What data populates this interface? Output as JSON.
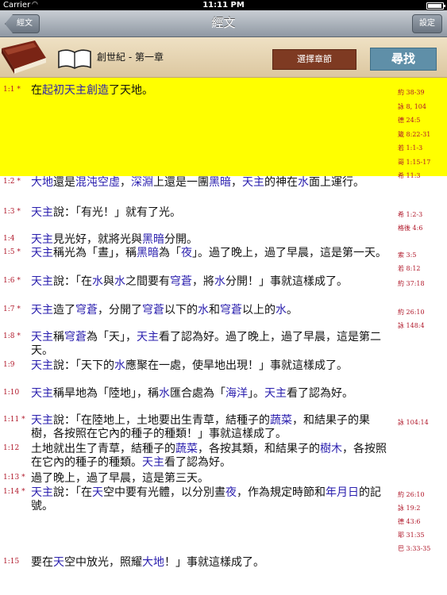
{
  "status": {
    "carrier": "Carrier",
    "wifi": "◠",
    "time": "11:11 PM",
    "battery_level": 0.95
  },
  "nav": {
    "back_label": "經文",
    "title": "經文",
    "settings_label": "設定"
  },
  "header": {
    "chapter_title": "創世紀 - 第一章",
    "select_label": "選擇章節",
    "search_label": "尋找"
  },
  "colors": {
    "highlight": "#ffff00",
    "keyword": "#2a1fae",
    "reference": "#b0182a",
    "select_button": "#7e3a22",
    "search_button": "#5f8fa8"
  },
  "verses": [
    {
      "num": "1:1 *",
      "highlight": true,
      "segments": [
        {
          "t": "在"
        },
        {
          "t": "起初",
          "k": 1
        },
        {
          "t": "天主",
          "k": 1
        },
        {
          "t": "創造",
          "k": 1
        },
        {
          "t": "了天地。"
        }
      ],
      "refs": [
        "約 38-39",
        "詠 8, 104",
        "德 24:5",
        "箴 8:22-31",
        "若 1:1-3",
        "哥 1:15-17",
        "希 11:3"
      ]
    },
    {
      "num": "1:2 *",
      "segments": [
        {
          "t": "大地",
          "k": 1
        },
        {
          "t": "還是"
        },
        {
          "t": "混沌",
          "k": 1
        },
        {
          "t": "空虛",
          "k": 1
        },
        {
          "t": "，"
        },
        {
          "t": "深淵",
          "k": 1
        },
        {
          "t": "上還是一團"
        },
        {
          "t": "黑暗",
          "k": 1
        },
        {
          "t": "，"
        },
        {
          "t": "天主",
          "k": 1
        },
        {
          "t": "的神在"
        },
        {
          "t": "水",
          "k": 1
        },
        {
          "t": "面上運行。"
        }
      ],
      "refs": []
    },
    {
      "num": "1:3 *",
      "segments": [
        {
          "t": "天主",
          "k": 1
        },
        {
          "t": "說：「有光！」就有了光。"
        }
      ],
      "refs": [
        "希 1:2-3",
        "格後 4:6"
      ]
    },
    {
      "num": "1:4",
      "segments": [
        {
          "t": "天主",
          "k": 1
        },
        {
          "t": "見光好，就將光與"
        },
        {
          "t": "黑暗",
          "k": 1
        },
        {
          "t": "分開。"
        }
      ],
      "refs": []
    },
    {
      "num": "1:5 *",
      "segments": [
        {
          "t": "天主",
          "k": 1
        },
        {
          "t": "稱光為「晝」，稱"
        },
        {
          "t": "黑暗",
          "k": 1
        },
        {
          "t": "為「"
        },
        {
          "t": "夜",
          "k": 1
        },
        {
          "t": "」。過了晚上，過了早晨，這是第一天。"
        }
      ],
      "refs": [
        "索 3:5",
        "若 8:12"
      ]
    },
    {
      "num": "1:6 *",
      "segments": [
        {
          "t": "天主",
          "k": 1
        },
        {
          "t": "說：「在"
        },
        {
          "t": "水",
          "k": 1
        },
        {
          "t": "與"
        },
        {
          "t": "水",
          "k": 1
        },
        {
          "t": "之間要有"
        },
        {
          "t": "穹蒼",
          "k": 1
        },
        {
          "t": "，將"
        },
        {
          "t": "水",
          "k": 1
        },
        {
          "t": "分開！」事就這樣成了。"
        }
      ],
      "refs": [
        "約 37:18"
      ]
    },
    {
      "num": "1:7 *",
      "segments": [
        {
          "t": "天主",
          "k": 1
        },
        {
          "t": "造了"
        },
        {
          "t": "穹蒼",
          "k": 1
        },
        {
          "t": "，分開了"
        },
        {
          "t": "穹蒼",
          "k": 1
        },
        {
          "t": "以下的"
        },
        {
          "t": "水",
          "k": 1
        },
        {
          "t": "和"
        },
        {
          "t": "穹蒼",
          "k": 1
        },
        {
          "t": "以上的"
        },
        {
          "t": "水",
          "k": 1
        },
        {
          "t": "。"
        }
      ],
      "refs": [
        "約 26:10",
        "詠 148:4"
      ]
    },
    {
      "num": "1:8 *",
      "segments": [
        {
          "t": "天主",
          "k": 1
        },
        {
          "t": "稱"
        },
        {
          "t": "穹蒼",
          "k": 1
        },
        {
          "t": "為「天」，"
        },
        {
          "t": "天主",
          "k": 1
        },
        {
          "t": "看了認為好。過了晚上，過了早晨，這是第二天。"
        }
      ],
      "refs": []
    },
    {
      "num": "1:9",
      "segments": [
        {
          "t": "天主",
          "k": 1
        },
        {
          "t": "說：「天下的"
        },
        {
          "t": "水",
          "k": 1
        },
        {
          "t": "應聚在一處，使旱地出現！」事就這樣成了。"
        }
      ],
      "refs": []
    },
    {
      "num": "1:10",
      "segments": [
        {
          "t": "天主",
          "k": 1
        },
        {
          "t": "稱旱地為「陸地」，稱"
        },
        {
          "t": "水",
          "k": 1
        },
        {
          "t": "匯合處為「"
        },
        {
          "t": "海洋",
          "k": 1
        },
        {
          "t": "」。"
        },
        {
          "t": "天主",
          "k": 1
        },
        {
          "t": "看了認為好。"
        }
      ],
      "refs": []
    },
    {
      "num": "1:11 *",
      "segments": [
        {
          "t": "天主",
          "k": 1
        },
        {
          "t": "說：「在陸地上，土地要出生青草，結種子的"
        },
        {
          "t": "蔬菜",
          "k": 1
        },
        {
          "t": "，和結果子的果樹，各按照在它內的種子的種類！」事就這樣成了。"
        }
      ],
      "refs": [
        "詠 104:14"
      ]
    },
    {
      "num": "1:12",
      "segments": [
        {
          "t": "土地就出生了青草，結種子的"
        },
        {
          "t": "蔬菜",
          "k": 1
        },
        {
          "t": "，各按其類，和結果子的"
        },
        {
          "t": "樹木",
          "k": 1
        },
        {
          "t": "，各按照在它內的種子的種類。"
        },
        {
          "t": "天主",
          "k": 1
        },
        {
          "t": "看了認為好。"
        }
      ],
      "refs": []
    },
    {
      "num": "1:13 *",
      "segments": [
        {
          "t": "過了晚上，過了早晨，這是第三天。"
        }
      ],
      "refs": []
    },
    {
      "num": "1:14 *",
      "segments": [
        {
          "t": "天主",
          "k": 1
        },
        {
          "t": "說：「在"
        },
        {
          "t": "天",
          "k": 1
        },
        {
          "t": "空中要有光體，以分別晝"
        },
        {
          "t": "夜",
          "k": 1
        },
        {
          "t": "，作為規定時節和"
        },
        {
          "t": "年月日",
          "k": 1
        },
        {
          "t": "的記號。"
        }
      ],
      "refs": [
        "約 26:10",
        "詠 19:2",
        "德 43:6",
        "耶 31:35",
        "巴 3:33-35"
      ]
    },
    {
      "num": "1:15",
      "segments": [
        {
          "t": "要在"
        },
        {
          "t": "天",
          "k": 1
        },
        {
          "t": "空中放光，照耀"
        },
        {
          "t": "大地",
          "k": 1
        },
        {
          "t": "！」事就這樣成了。"
        }
      ],
      "refs": []
    }
  ]
}
